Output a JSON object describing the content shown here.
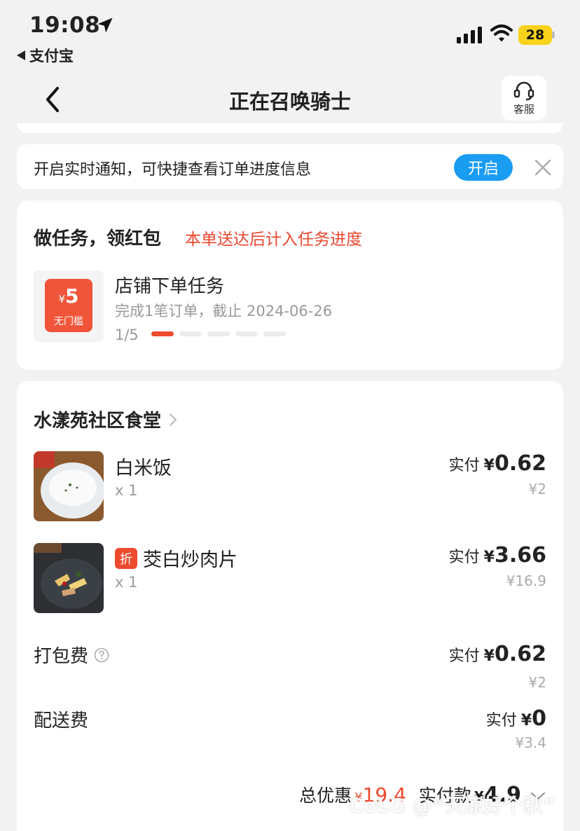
{
  "status_bar": {
    "time": "19:08",
    "back_app": "支付宝",
    "battery": "28"
  },
  "nav": {
    "title": "正在召唤骑士",
    "service_label": "客服"
  },
  "notice": {
    "text": "开启实时通知，可快捷查看订单进度信息",
    "button": "开启"
  },
  "task": {
    "title": "做任务，领红包",
    "note": "本单送达后计入任务进度",
    "coupon_currency": "¥",
    "coupon_amount": "5",
    "coupon_tag": "无门槛",
    "name": "店铺下单任务",
    "desc": "完成1笔订单，截止 2024-06-26",
    "progress": "1/5",
    "progress_done": 1,
    "progress_total": 5
  },
  "order": {
    "shop_name": "水漾苑社区食堂",
    "items": [
      {
        "name": "白米饭",
        "qty": "x 1",
        "pay_label": "实付",
        "currency": "¥",
        "pay": "0.62",
        "orig": "¥2",
        "badge": ""
      },
      {
        "name": "茭白炒肉片",
        "qty": "x 1",
        "pay_label": "实付",
        "currency": "¥",
        "pay": "3.66",
        "orig": "¥16.9",
        "badge": "折"
      }
    ],
    "fees": [
      {
        "name": "打包费",
        "pay_label": "实付",
        "currency": "¥",
        "pay": "0.62",
        "orig": "¥2"
      },
      {
        "name": "配送费",
        "pay_label": "实付",
        "currency": "¥",
        "pay": "0",
        "orig": "¥3.4"
      }
    ],
    "total": {
      "discount_label": "总优惠",
      "discount_currency": "¥",
      "discount_amount": "19.4",
      "paid_label": "实付款",
      "paid_currency": "¥",
      "paid_amount": "4.9"
    }
  },
  "watermark": "CoLG @“天凉好个秋”",
  "colors": {
    "accent_blue": "#1a9cf2",
    "accent_red": "#ee4a2e",
    "battery_yellow": "#f8d21b"
  }
}
